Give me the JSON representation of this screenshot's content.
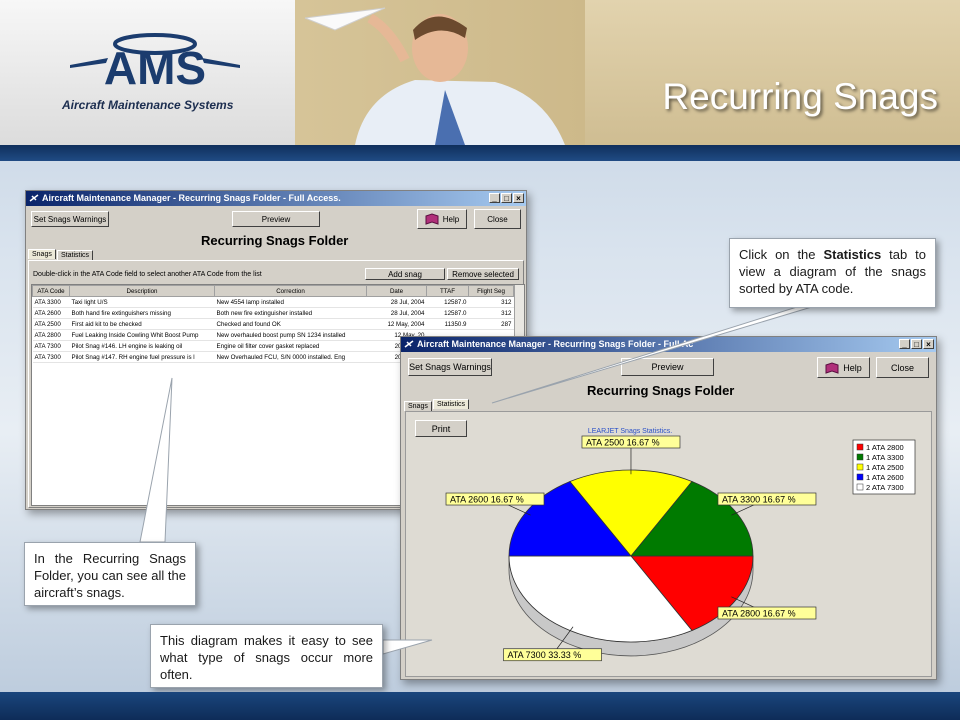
{
  "slide": {
    "title": "Recurring Snags",
    "logo_text": "AMS",
    "logo_subtitle": "Aircraft Maintenance Systems"
  },
  "window1": {
    "title": "Aircraft Maintenance Manager - Recurring Snags Folder - Full Access.",
    "buttons": {
      "set_warnings": "Set Snags Warnings",
      "preview": "Preview",
      "help": "Help",
      "close": "Close"
    },
    "folder_title": "Recurring Snags Folder",
    "tabs": [
      "Snags",
      "Statistics"
    ],
    "hint": "Double-click in the ATA Code field to select another ATA Code from the list",
    "add_snag": "Add snag",
    "remove_selected": "Remove selected",
    "columns": [
      "ATA Code",
      "Description",
      "Correction",
      "Date",
      "TTAF",
      "Flight Seg"
    ],
    "rows": [
      [
        "ATA 3300",
        "Taxi light U/S",
        "New 4554 lamp installed",
        "28 Jul, 2004",
        "12587.0",
        "312"
      ],
      [
        "ATA 2600",
        "Both hand fire extinguishers missing",
        "Both new fire extinguisher installed",
        "28 Jul, 2004",
        "12587.0",
        "312"
      ],
      [
        "ATA 2500",
        "First aid kit to be checked",
        "Checked and found OK",
        "12 May, 2004",
        "11350.9",
        "287"
      ],
      [
        "ATA 2800",
        "Fuel Leaking Inside Cowling Whit Boost Pump",
        "New overhauled boost pump SN 1234 installed",
        "12 May, 20",
        "",
        ""
      ],
      [
        "ATA 7300",
        "Pilot Snag #146. LH engine is leaking oil",
        "Engine oil filter cover gasket replaced",
        "20 Sep, 20",
        "",
        ""
      ],
      [
        "ATA 7300",
        "Pilot Snag #147. RH engine fuel pressure is l",
        "New Overhauled FCU, S/N 0000 installed. Eng",
        "20 Sep, 20",
        "",
        ""
      ]
    ]
  },
  "window2": {
    "title": "Aircraft Maintenance Manager - Recurring Snags Folder - Full Ac",
    "buttons": {
      "set_warnings": "Set Snags Warnings",
      "preview": "Preview",
      "help": "Help",
      "close": "Close"
    },
    "folder_title": "Recurring Snags Folder",
    "tabs": [
      "Snags",
      "Statistics"
    ],
    "print": "Print"
  },
  "chart_data": {
    "type": "pie",
    "title": "LEARJET Snags Statistics.",
    "slices": [
      {
        "label": "ATA 2800 16.67 %",
        "value": 16.67,
        "color": "#ff0000"
      },
      {
        "label": "ATA 7300 33.33 %",
        "value": 33.33,
        "color": "#ffffff"
      },
      {
        "label": "ATA 2600 16.67 %",
        "value": 16.67,
        "color": "#0000ff"
      },
      {
        "label": "ATA 2500 16.67 %",
        "value": 16.67,
        "color": "#ffff00"
      },
      {
        "label": "ATA 3300 16.67 %",
        "value": 16.67,
        "color": "#007a00"
      }
    ],
    "legend": [
      {
        "label": "1 ATA 2800",
        "color": "#ff0000"
      },
      {
        "label": "1 ATA 3300",
        "color": "#007a00"
      },
      {
        "label": "1 ATA 2500",
        "color": "#ffff00"
      },
      {
        "label": "1 ATA 2600",
        "color": "#0000ff"
      },
      {
        "label": "2 ATA 7300",
        "color": "#ffffff"
      }
    ],
    "legend_position": "right"
  },
  "callouts": {
    "statistics_pre": "Click on the ",
    "statistics_bold": "Statistics",
    "statistics_post": " tab to view a diagram of the snags sorted by ATA code.",
    "folder": "In the Recurring Snags Folder, you can see all the aircraft’s snags.",
    "diagram": "This diagram makes it easy to see what type of snags occur more often."
  }
}
